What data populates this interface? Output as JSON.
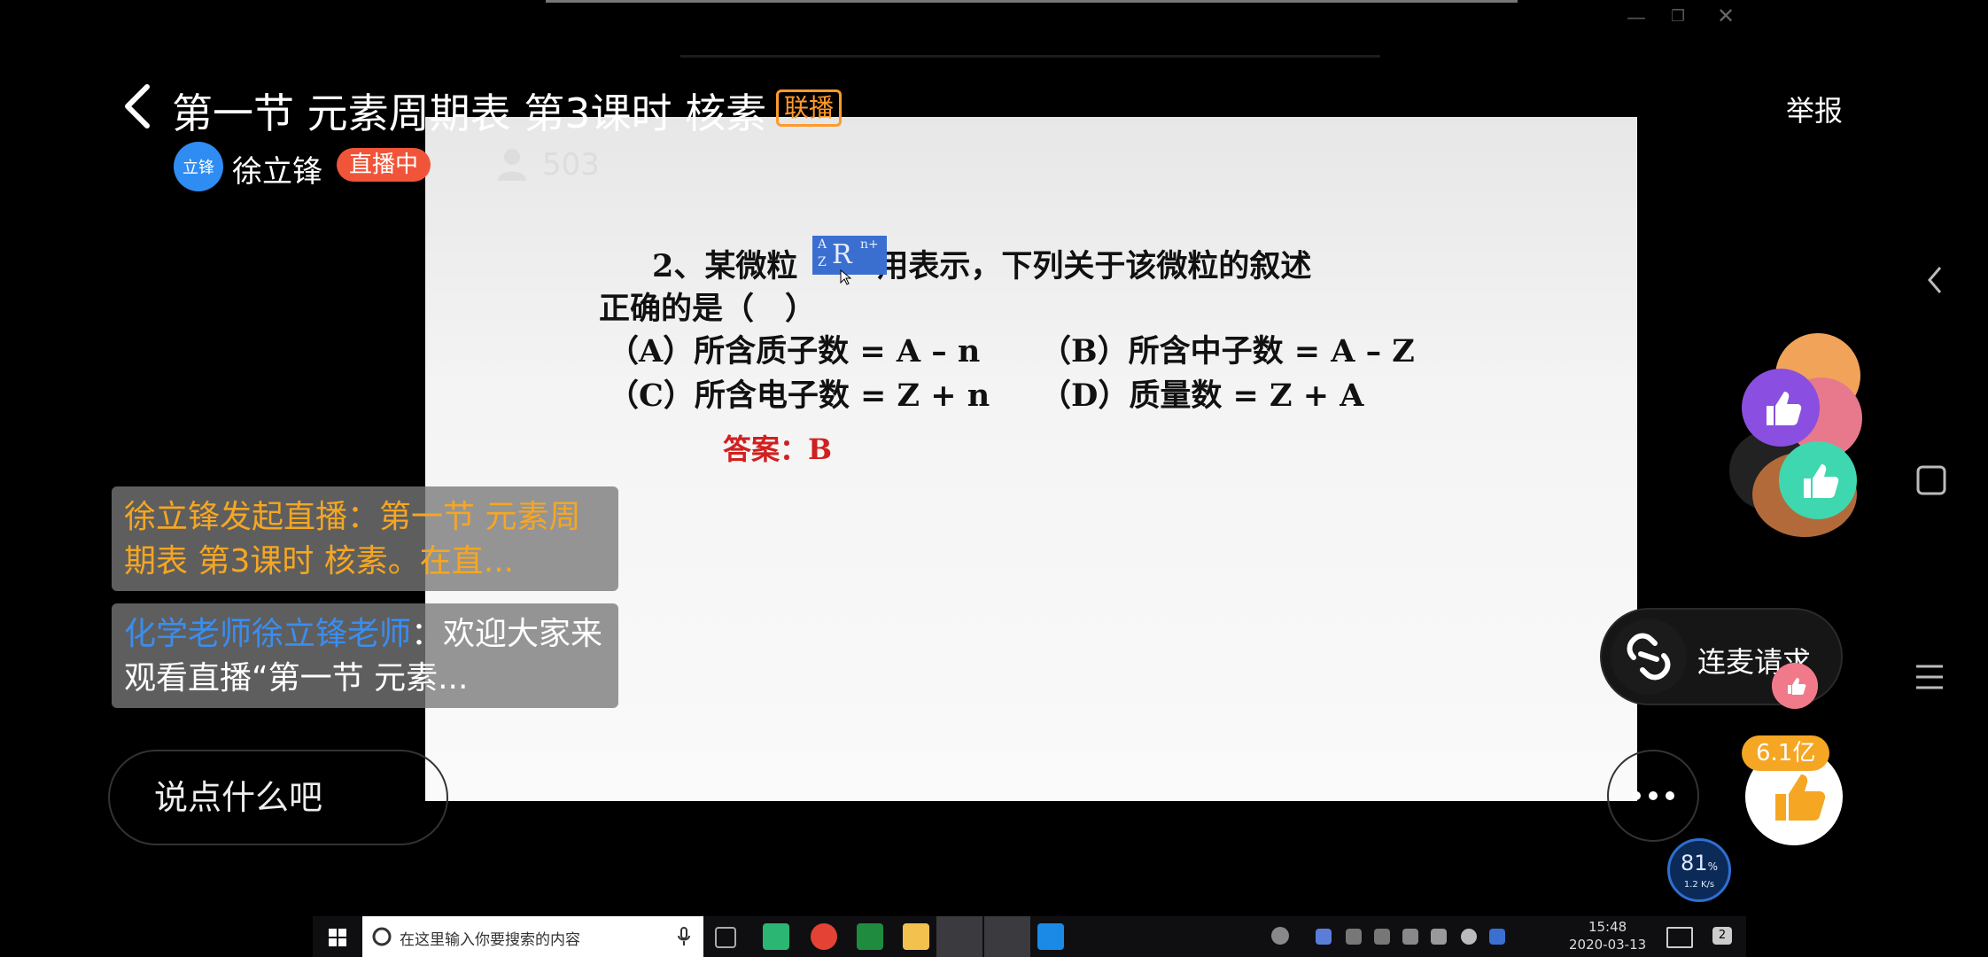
{
  "header": {
    "title": "第一节 元素周期表 第3课时 核素",
    "badge": "联播",
    "report_label": "举报"
  },
  "host": {
    "avatar_text": "立锋",
    "name": "徐立锋",
    "status": "直播中",
    "viewer_count": "503"
  },
  "slide": {
    "q_line1_pre": "2、某微粒",
    "q_line1_post": "用表示，下列关于该微粒的叙述",
    "symbol": {
      "mass": "A",
      "atomic": "Z",
      "element": "R",
      "charge": "n+"
    },
    "q_line2": "正确的是（　）",
    "options": {
      "a": "（A）所含质子数 = A – n",
      "b": "（B）所含中子数 = A – Z",
      "c": "（C）所含电子数 = Z + n",
      "d": "（D）质量数 = Z + A"
    },
    "answer": "答案：B"
  },
  "chat": [
    {
      "text": "徐立锋发起直播：第一节 元素周期表 第3课时 核素。在直..."
    },
    {
      "sender": "化学老师徐立锋老师",
      "text": "：欢迎大家来观看直播“第一节 元素..."
    }
  ],
  "comment_placeholder": "说点什么吧",
  "lianmai_label": "连麦请求",
  "like_count": "6.1亿",
  "speed": {
    "percent": "81",
    "unit": "%",
    "rate": "1.2 K/s"
  },
  "taskbar": {
    "search_placeholder": "在这里输入你要搜索的内容",
    "time": "15:48",
    "date": "2020-03-13",
    "notification_count": "2"
  },
  "colors": {
    "live_badge": "#f0553a",
    "chat_system": "#f5a623",
    "chat_sender": "#3b8df0",
    "like_count_bg": "#f5a623"
  }
}
